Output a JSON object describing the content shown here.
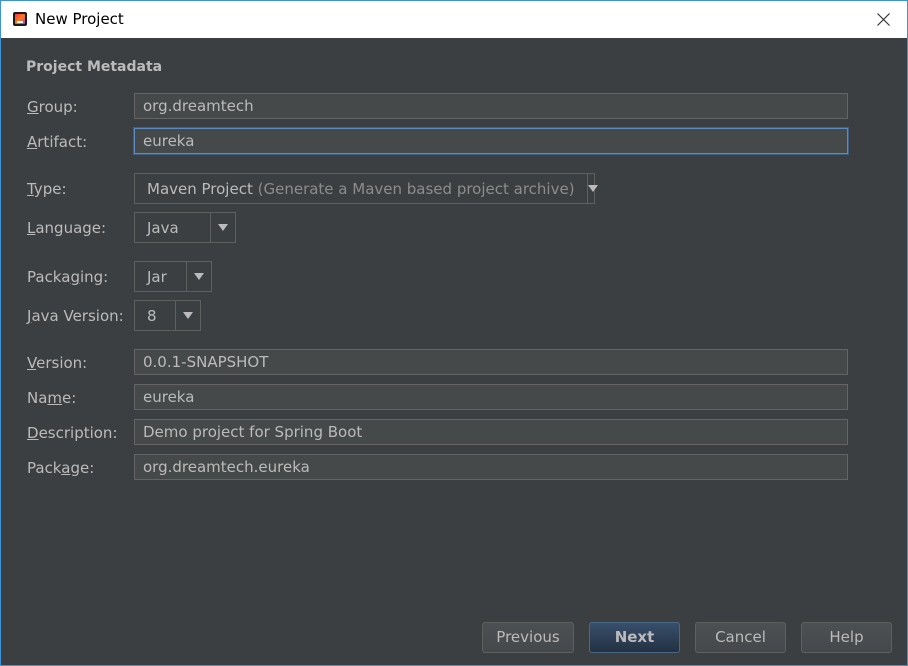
{
  "window": {
    "title": "New Project"
  },
  "section": {
    "title": "Project Metadata"
  },
  "fields": {
    "group": {
      "label_pre": "",
      "label_mn": "G",
      "label_post": "roup:",
      "value": "org.dreamtech"
    },
    "artifact": {
      "label_pre": "",
      "label_mn": "A",
      "label_post": "rtifact:",
      "value": "eureka"
    },
    "version": {
      "label_pre": "",
      "label_mn": "V",
      "label_post": "ersion:",
      "value": "0.0.1-SNAPSHOT"
    },
    "name": {
      "label_pre": "Na",
      "label_mn": "m",
      "label_post": "e:",
      "value": "eureka"
    },
    "description": {
      "label_pre": "",
      "label_mn": "D",
      "label_post": "escription:",
      "value": "Demo project for Spring Boot"
    },
    "package": {
      "label_pre": "Pack",
      "label_mn": "a",
      "label_post": "ge:",
      "value": "org.dreamtech.eureka"
    }
  },
  "combos": {
    "type": {
      "label_pre": "",
      "label_mn": "T",
      "label_post": "ype:",
      "value": "Maven Project",
      "hint": "(Generate a Maven based project archive)"
    },
    "language": {
      "label_pre": "",
      "label_mn": "L",
      "label_post": "anguage:",
      "value": "Java"
    },
    "packaging": {
      "label_pre": "Packa",
      "label_mn": "g",
      "label_post": "ing:",
      "value": "Jar"
    },
    "java_version": {
      "label_pre": "",
      "label_mn": "J",
      "label_post": "ava Version:",
      "value": "8"
    }
  },
  "buttons": {
    "previous": "Previous",
    "next": "Next",
    "cancel": "Cancel",
    "help": "Help"
  },
  "icons": {
    "app": "intellij-idea-icon",
    "close": "close-icon",
    "dropdown": "triangle-down-icon"
  },
  "colors": {
    "accent": "#3c93d8",
    "background": "#3c3f41",
    "field_bg": "#45494a",
    "focus_border": "#5d8ac0",
    "default_button": "#2f4259"
  }
}
